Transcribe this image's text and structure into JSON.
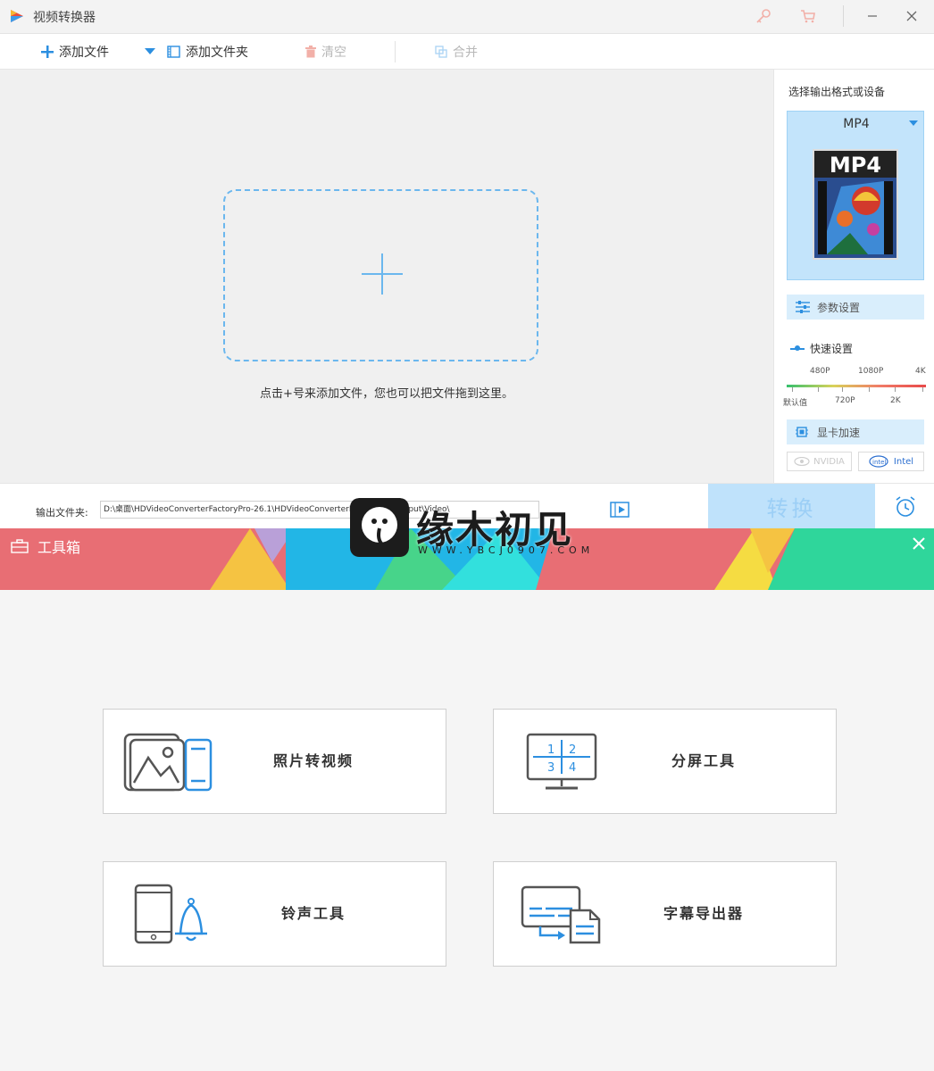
{
  "window": {
    "title": "视频转换器",
    "minimize_icon": "minimize-icon",
    "close_icon": "close-icon"
  },
  "toolbar": {
    "add_file": "添加文件",
    "add_folder": "添加文件夹",
    "clear": "清空",
    "merge": "合并"
  },
  "dropzone": {
    "hint": "点击+号来添加文件，您也可以把文件拖到这里。"
  },
  "side": {
    "title": "选择输出格式或设备",
    "format": "MP4",
    "thumb_label": "MP4",
    "params": "参数设置",
    "quick_settings": "快速设置",
    "quality_top": [
      "480P",
      "1080P",
      "4K"
    ],
    "quality_bottom": [
      "默认值",
      "720P",
      "2K"
    ],
    "gpu": "显卡加速",
    "nvidia": "NVIDIA",
    "intel": "Intel"
  },
  "output": {
    "label": "输出文件夹:",
    "path": "D:\\桌面\\HDVideoConverterFactoryPro-26.1\\HDVideoConverterFactoryPro\\Output\\Video\\",
    "convert": "转换"
  },
  "watermark": {
    "text": "缘木初见",
    "url": "WWW.YBCJ0907.COM"
  },
  "toolbox": {
    "title": "工具箱",
    "tools": [
      {
        "label": "照片转视频",
        "icon": "photo-to-video-icon"
      },
      {
        "label": "分屏工具",
        "icon": "split-screen-icon"
      },
      {
        "label": "铃声工具",
        "icon": "ringtone-icon"
      },
      {
        "label": "字幕导出器",
        "icon": "subtitle-export-icon"
      }
    ]
  },
  "colors": {
    "accent": "#2c8fe0",
    "convert_bg": "#bfe2fb",
    "banner_red": "#e86e74"
  }
}
